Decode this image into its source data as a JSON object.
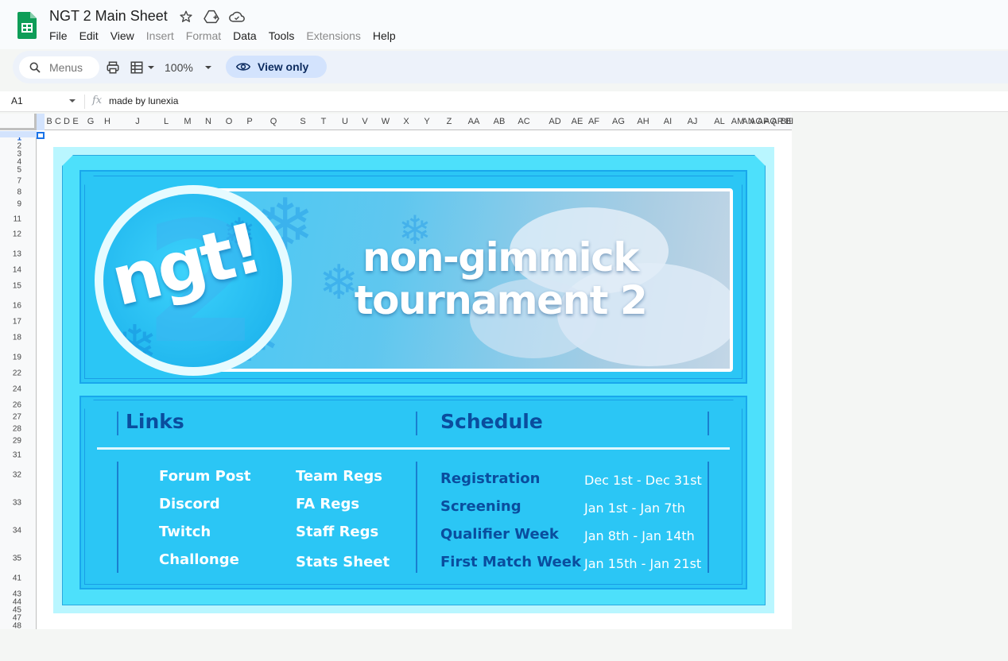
{
  "app": {
    "doc_title": "NGT 2 Main Sheet",
    "menu": [
      {
        "label": "File",
        "enabled": true
      },
      {
        "label": "Edit",
        "enabled": true
      },
      {
        "label": "View",
        "enabled": true
      },
      {
        "label": "Insert",
        "enabled": false
      },
      {
        "label": "Format",
        "enabled": false
      },
      {
        "label": "Data",
        "enabled": true
      },
      {
        "label": "Tools",
        "enabled": true
      },
      {
        "label": "Extensions",
        "enabled": false
      },
      {
        "label": "Help",
        "enabled": true
      }
    ]
  },
  "toolbar": {
    "search_placeholder": "Menus",
    "zoom": "100%",
    "view_only_label": "View only"
  },
  "formula_bar": {
    "cell_ref": "A1",
    "fx": "fx",
    "content": "made by lunexia"
  },
  "grid": {
    "columns": [
      "A",
      "B",
      "C",
      "D",
      "E",
      "G",
      "H",
      "J",
      "L",
      "M",
      "N",
      "O",
      "P",
      "Q",
      "S",
      "T",
      "U",
      "V",
      "W",
      "X",
      "Y",
      "Z",
      "AA",
      "AB",
      "AC",
      "AD",
      "AE",
      "AF",
      "AG",
      "AH",
      "AI",
      "AJ",
      "AL",
      "AM",
      "AN",
      "AO",
      "AP",
      "AQ",
      "AR",
      "BE",
      "BI"
    ],
    "rows": [
      "1",
      "2",
      "3",
      "4",
      "5",
      "6",
      "7",
      "8",
      "9",
      "11",
      "12",
      "13",
      "14",
      "15",
      "16",
      "17",
      "18",
      "19",
      "22",
      "24",
      "26",
      "27",
      "28",
      "29",
      "31",
      "32",
      "33",
      "34",
      "35",
      "41",
      "43",
      "44",
      "45",
      "47",
      "48"
    ]
  },
  "banner": {
    "logo_text": "ngt!",
    "logo_number": "2",
    "title_line1": "non-gimmick",
    "title_line2": "tournament 2"
  },
  "links": {
    "heading": "Links",
    "left": [
      "Forum Post",
      "Discord",
      "Twitch",
      "Challonge"
    ],
    "right": [
      "Team Regs",
      "FA Regs",
      "Staff Regs",
      "Stats Sheet"
    ]
  },
  "schedule": {
    "heading": "Schedule",
    "items": [
      {
        "label": "Registration",
        "dates": "Dec 1st - Dec 31st"
      },
      {
        "label": "Screening",
        "dates": "Jan 1st - Jan 7th"
      },
      {
        "label": "Qualifier Week",
        "dates": "Jan 8th - Jan 14th"
      },
      {
        "label": "First Match Week",
        "dates": "Jan 15th - Jan 21st"
      }
    ]
  },
  "colors": {
    "sheets_green": "#0f9d58",
    "accent_blue": "#0b57d0",
    "banner_cyan": "#2bc6f5",
    "heading_navy": "#0a4d9e"
  }
}
